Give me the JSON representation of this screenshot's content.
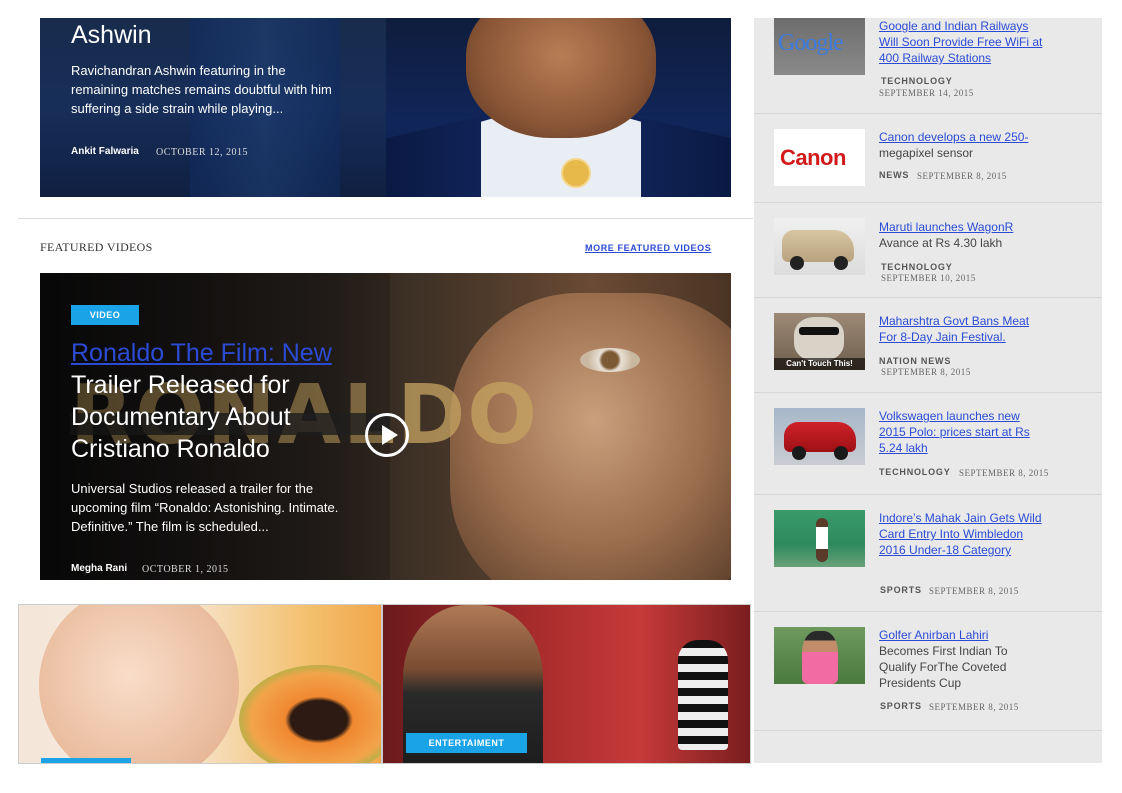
{
  "hero": {
    "title": "Ashwin",
    "description": "Ravichandran Ashwin featuring in the remaining matches remains doubtful with him suffering a side strain while playing...",
    "author": "Ankit Falwaria",
    "date": "OCTOBER 12, 2015"
  },
  "featured": {
    "section_title": "FEATURED VIDEOS",
    "more_link": "MORE FEATURED VIDEOS",
    "tag": "VIDEO",
    "title_link": "Ronaldo The Film: New",
    "title_rest": "Trailer Released for Documentary About Cristiano Ronaldo",
    "description": "Universal Studios released a trailer for the upcoming film “Ronaldo: Astonishing. Intimate. Definitive.” The film is scheduled...",
    "author": "Megha Rani",
    "date": "OCTOBER 1, 2015",
    "poster_word": "RONALDO"
  },
  "bottom_cards": {
    "right_tag": "ENTERTAIMENT"
  },
  "sidebar": {
    "items": [
      {
        "link": "Google and Indian Railways Will Soon Provide Free WiFi at 400 Railway Stations",
        "text": "",
        "category": "TECHNOLOGY",
        "date": "SEPTEMBER 14, 2015",
        "thumb_label": "Google"
      },
      {
        "link": "Canon develops a new 250-",
        "text": "megapixel sensor",
        "category": "NEWS",
        "date": "SEPTEMBER 8, 2015",
        "thumb_label": "Canon"
      },
      {
        "link": "Maruti launches WagonR",
        "text": "Avance at Rs 4.30 lakh",
        "category": "TECHNOLOGY",
        "date": "SEPTEMBER 10, 2015"
      },
      {
        "link": "Maharshtra Govt Bans Meat For 8-Day Jain Festival.",
        "text": "",
        "category": "NATION NEWS",
        "date": "SEPTEMBER 8, 2015",
        "thumb_label": "Can't Touch This!"
      },
      {
        "link": "Volkswagen launches new 2015 Polo: prices start at Rs 5.24 lakh",
        "text": "",
        "category": "TECHNOLOGY",
        "date": "SEPTEMBER 8, 2015"
      },
      {
        "link": "Indore’s Mahak Jain Gets Wild Card Entry Into Wimbledon 2016 Under-18 Category",
        "text": "",
        "category": "SPORTS",
        "date": "SEPTEMBER 8, 2015"
      },
      {
        "link": "Golfer Anirban Lahiri",
        "text": "Becomes First Indian To Qualify ForThe Coveted Presidents Cup",
        "category": "SPORTS",
        "date": "SEPTEMBER 8, 2015"
      }
    ]
  }
}
